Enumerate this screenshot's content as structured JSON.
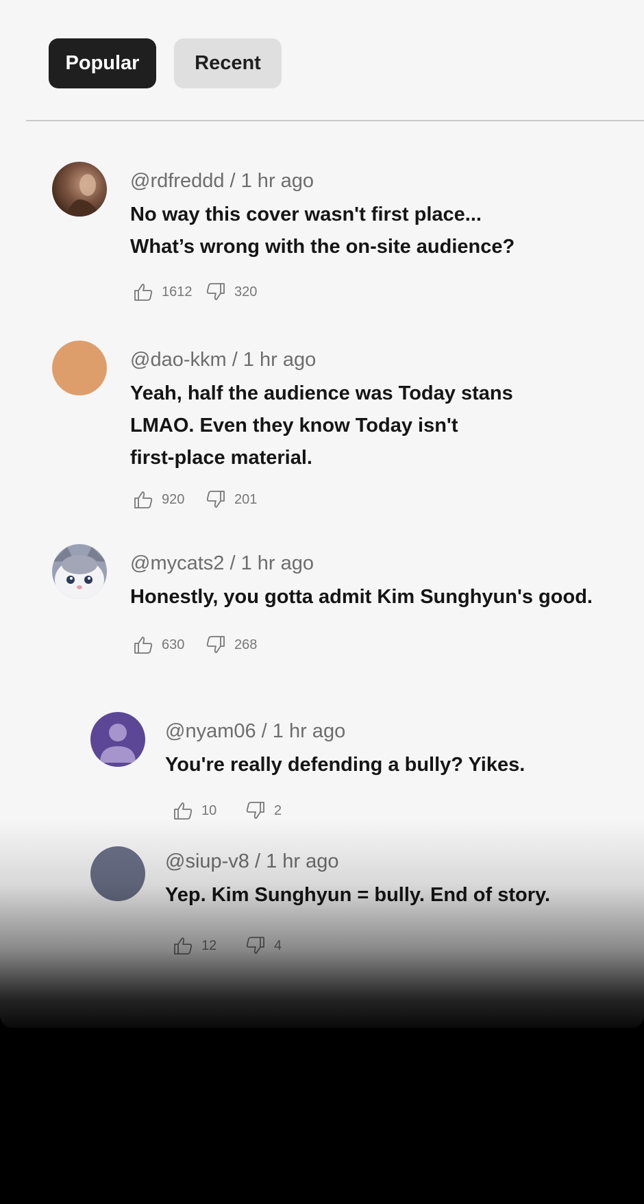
{
  "tabs": {
    "popular": "Popular",
    "recent": "Recent"
  },
  "comments": [
    {
      "meta": "@rdfreddd / 1 hr ago",
      "lines": [
        "No way this cover wasn't first place...",
        "What’s wrong with the on-site audience?"
      ],
      "likes": "1612",
      "dislikes": "320",
      "avatar_color": "#6b4a36"
    },
    {
      "meta": "@dao-kkm / 1 hr ago",
      "lines": [
        "Yeah, half the audience was Today stans",
        "LMAO. Even they know Today isn't",
        "first-place material."
      ],
      "likes": "920",
      "dislikes": "201",
      "avatar_color": "#de9e6b"
    },
    {
      "meta": "@mycats2 / 1 hr ago",
      "lines": [
        "Honestly, you gotta admit Kim Sunghyun's good."
      ],
      "likes": "630",
      "dislikes": "268",
      "avatar_color": "#8a8fa3"
    },
    {
      "meta": "@nyam06 / 1 hr ago",
      "lines": [
        "You're really defending a bully? Yikes."
      ],
      "likes": "10",
      "dislikes": "2",
      "avatar_color": "#5b4796"
    },
    {
      "meta": "@siup-v8 / 1 hr ago",
      "lines": [
        "Yep. Kim Sunghyun = bully. End of story."
      ],
      "likes": "12",
      "dislikes": "4",
      "avatar_color": "#6a7088"
    }
  ],
  "icons": {
    "like": "thumbs-up-icon",
    "dislike": "thumbs-down-icon"
  }
}
